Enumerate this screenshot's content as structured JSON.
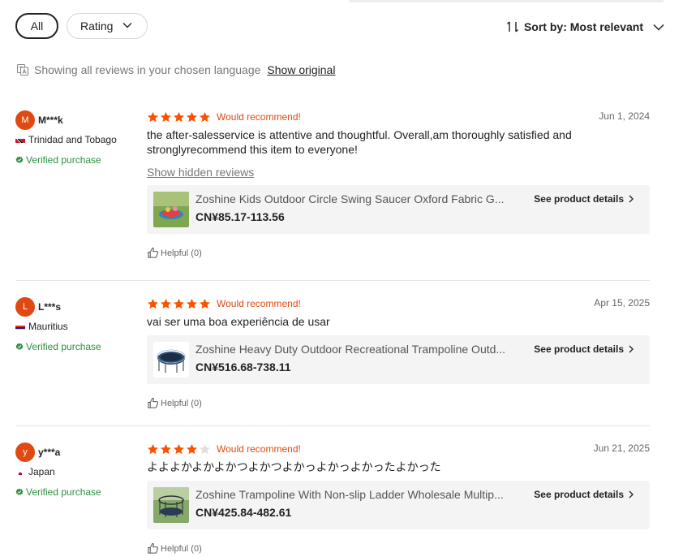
{
  "filters": {
    "all_label": "All",
    "rating_label": "Rating"
  },
  "sort": {
    "label": "Sort by: Most relevant"
  },
  "language": {
    "notice": "Showing all reviews in your chosen language",
    "show_original": "Show original"
  },
  "colors": {
    "star": "#fb5200",
    "accent": "#e04a12",
    "verified": "#2d8f3e"
  },
  "reviews": [
    {
      "avatar_letter": "M",
      "author": "M***k",
      "country": "Trinidad and Tobago",
      "verified": "Verified purchase",
      "rating": 5,
      "recommend": "Would recommend!",
      "date": "Jun 1, 2024",
      "text": "the after-salesservice is attentive and thoughtful. Overall,am thoroughly satisfied and stronglyrecommend this item to everyone!",
      "hidden_link": "Show hidden reviews",
      "product": {
        "title": "Zoshine Kids Outdoor Circle Swing Saucer Oxford Fabric G...",
        "price": "CN¥85.17-113.56",
        "details": "See product details"
      },
      "helpful": "Helpful (0)"
    },
    {
      "avatar_letter": "L",
      "author": "L***s",
      "country": "Mauritius",
      "verified": "Verified purchase",
      "rating": 5,
      "recommend": "Would recommend!",
      "date": "Apr 15, 2025",
      "text": "vai ser uma boa experiência de usar",
      "product": {
        "title": "Zoshine Heavy Duty Outdoor Recreational Trampoline Outd...",
        "price": "CN¥516.68-738.11",
        "details": "See product details"
      },
      "helpful": "Helpful (0)"
    },
    {
      "avatar_letter": "y",
      "author": "y***a",
      "country": "Japan",
      "verified": "Verified purchase",
      "rating": 4,
      "recommend": "Would recommend!",
      "date": "Jun 21, 2025",
      "text": "よよよかよかよかつよかつよかっよかっよかったよかった",
      "product": {
        "title": "Zoshine Trampoline With Non-slip Ladder Wholesale Multip...",
        "price": "CN¥425.84-482.61",
        "details": "See product details"
      },
      "helpful": "Helpful (0)"
    }
  ]
}
